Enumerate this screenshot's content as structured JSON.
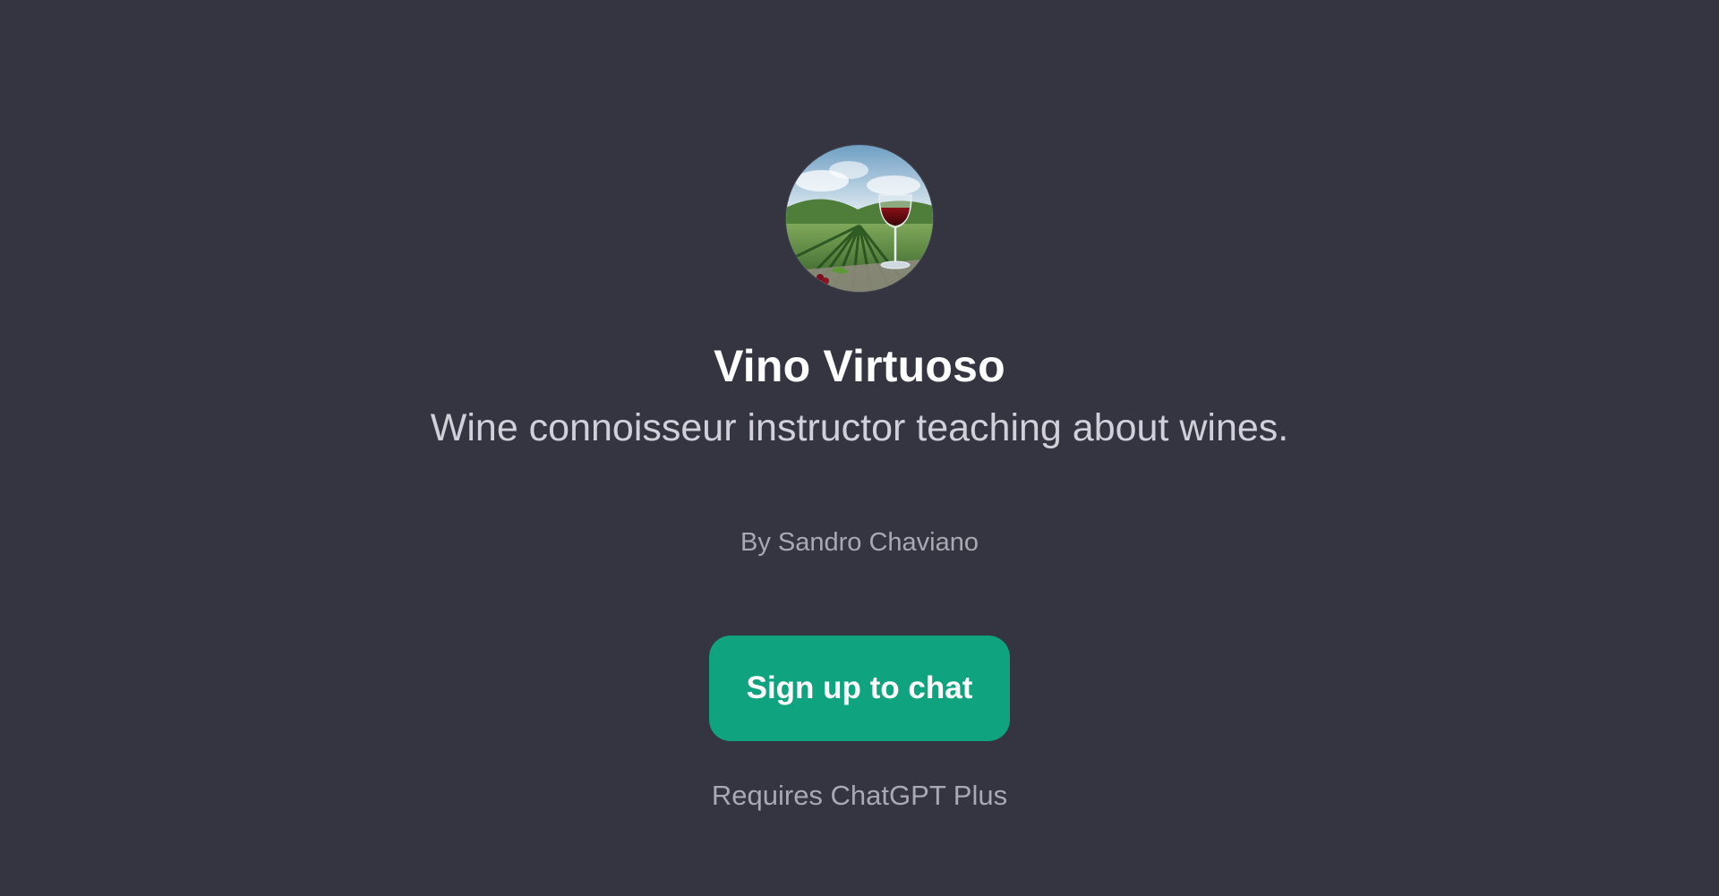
{
  "gpt": {
    "name": "Vino Virtuoso",
    "description": "Wine connoisseur instructor teaching about wines.",
    "author": "By Sandro Chaviano",
    "avatar_icon": "vineyard-wine-glass-avatar"
  },
  "actions": {
    "signup_label": "Sign up to chat"
  },
  "footer": {
    "requirement": "Requires ChatGPT Plus"
  },
  "colors": {
    "background": "#343541",
    "accent": "#10a37f",
    "title": "#ffffff",
    "subtitle": "#d1d0da",
    "muted": "#a9a8b3"
  }
}
